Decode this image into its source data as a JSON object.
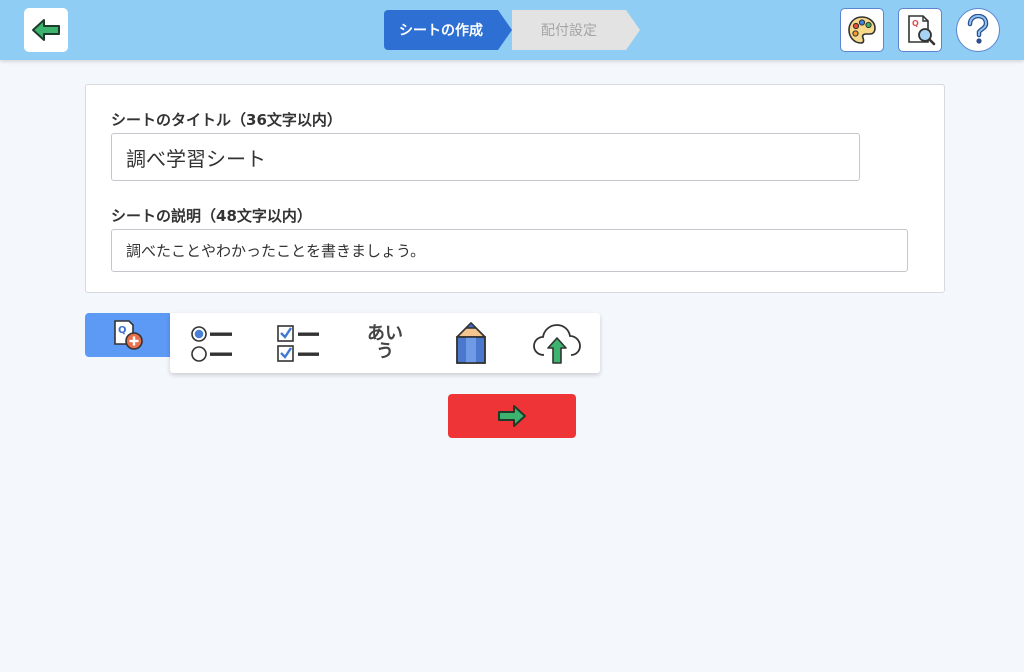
{
  "header": {
    "steps": [
      {
        "label": "シートの作成",
        "active": true
      },
      {
        "label": "配付設定",
        "active": false
      }
    ],
    "icons": {
      "back": "arrow-left-icon",
      "theme": "palette-icon",
      "preview": "document-search-icon",
      "help": "question-icon"
    }
  },
  "form": {
    "title_label": "シートのタイトル（36文字以内）",
    "title_value": "調べ学習シート",
    "description_label": "シートの説明（48文字以内）",
    "description_value": "調べたことやわかったことを書きましょう。"
  },
  "palette": {
    "add_icon": "add-question-icon",
    "items": [
      {
        "icon": "single-choice-icon"
      },
      {
        "icon": "multiple-choice-icon"
      },
      {
        "icon": "text-answer-icon",
        "text_top": "あい",
        "text_bottom": "う"
      },
      {
        "icon": "pencil-icon"
      },
      {
        "icon": "cloud-upload-icon"
      }
    ]
  },
  "footer": {
    "next_icon": "arrow-right-icon"
  },
  "colors": {
    "header_bg": "#8fcdf4",
    "step_active": "#2d6fd3",
    "step_inactive": "#e3e3e3",
    "add_button": "#5d9af5",
    "next_button": "#ee3436",
    "arrow_green": "#3db46d"
  }
}
